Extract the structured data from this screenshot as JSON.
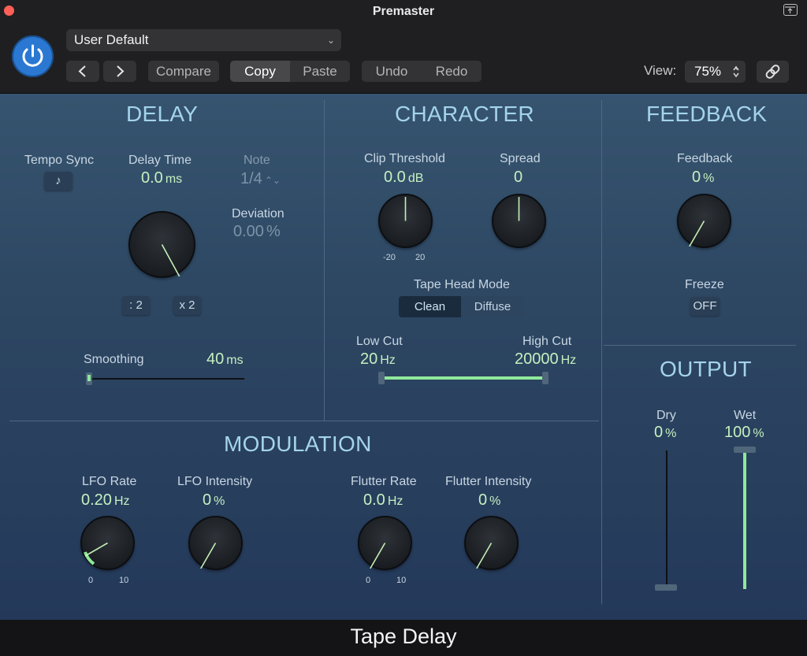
{
  "window": {
    "title": "Premaster",
    "footer": "Tape Delay"
  },
  "toolbar": {
    "preset": "User Default",
    "compare": "Compare",
    "copy": "Copy",
    "paste": "Paste",
    "undo": "Undo",
    "redo": "Redo",
    "view_label": "View:",
    "view_value": "75%"
  },
  "delay": {
    "title": "DELAY",
    "tempo_sync_label": "Tempo Sync",
    "delay_time_label": "Delay Time",
    "delay_time_value": "0.0",
    "delay_time_unit": "ms",
    "note_label": "Note",
    "note_value": "1/4",
    "deviation_label": "Deviation",
    "deviation_value": "0.00",
    "deviation_unit": "%",
    "half_btn": ": 2",
    "double_btn": "x 2",
    "smoothing_label": "Smoothing",
    "smoothing_value": "40",
    "smoothing_unit": "ms"
  },
  "character": {
    "title": "CHARACTER",
    "clip_label": "Clip Threshold",
    "clip_value": "0.0",
    "clip_unit": "dB",
    "clip_min": "-20",
    "clip_max": "20",
    "spread_label": "Spread",
    "spread_value": "0",
    "tape_head_label": "Tape Head Mode",
    "clean": "Clean",
    "diffuse": "Diffuse",
    "lowcut_label": "Low Cut",
    "lowcut_value": "20",
    "lowcut_unit": "Hz",
    "highcut_label": "High Cut",
    "highcut_value": "20000",
    "highcut_unit": "Hz"
  },
  "feedback": {
    "title": "FEEDBACK",
    "feedback_label": "Feedback",
    "feedback_value": "0",
    "feedback_unit": "%",
    "freeze_label": "Freeze",
    "freeze_value": "OFF"
  },
  "modulation": {
    "title": "MODULATION",
    "lfo_rate_label": "LFO Rate",
    "lfo_rate_value": "0.20",
    "lfo_rate_unit": "Hz",
    "lfo_rate_min": "0",
    "lfo_rate_max": "10",
    "lfo_int_label": "LFO Intensity",
    "lfo_int_value": "0",
    "lfo_int_unit": "%",
    "flutter_rate_label": "Flutter Rate",
    "flutter_rate_value": "0.0",
    "flutter_rate_unit": "Hz",
    "flutter_rate_min": "0",
    "flutter_rate_max": "10",
    "flutter_int_label": "Flutter Intensity",
    "flutter_int_value": "0",
    "flutter_int_unit": "%"
  },
  "output": {
    "title": "OUTPUT",
    "dry_label": "Dry",
    "dry_value": "0",
    "dry_unit": "%",
    "dry_level": 0,
    "wet_label": "Wet",
    "wet_value": "100",
    "wet_unit": "%",
    "wet_level": 1.0
  },
  "colors": {
    "accent": "#8fe89a",
    "power": "#2a78d2",
    "section_title": "#a4d4ec"
  }
}
